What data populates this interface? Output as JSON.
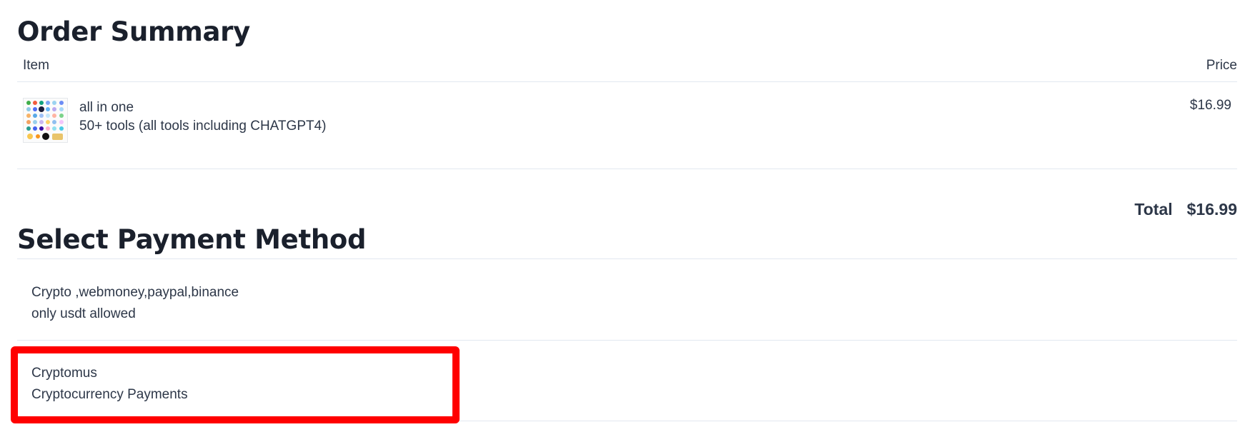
{
  "order_summary": {
    "title": "Order Summary",
    "columns": {
      "item": "Item",
      "price": "Price"
    },
    "items": [
      {
        "name": "all in one",
        "description": "50+ tools (all tools including CHATGPT4)",
        "price": "$16.99"
      }
    ],
    "total_label": "Total",
    "total_value": "$16.99"
  },
  "payment": {
    "title": "Select Payment Method",
    "methods": [
      {
        "name": "Crypto ,webmoney,paypal,binance",
        "description": "only usdt allowed"
      },
      {
        "name": "Cryptomus",
        "description": "Cryptocurrency Payments"
      }
    ]
  },
  "highlight": {
    "target": "Cryptomus",
    "color": "#ff0000"
  }
}
